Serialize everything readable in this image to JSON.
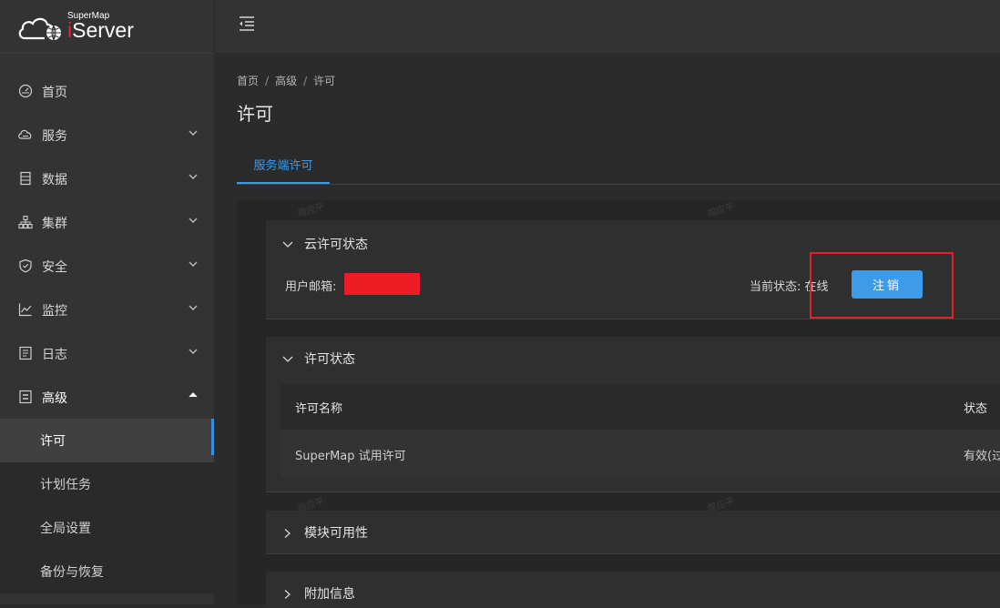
{
  "brand": {
    "small": "SuperMap",
    "prefix": "i",
    "name": "Server"
  },
  "sidebar": {
    "items": [
      {
        "label": "首页",
        "icon": "dashboard-icon",
        "has_children": false
      },
      {
        "label": "服务",
        "icon": "cloud-service-icon",
        "has_children": true
      },
      {
        "label": "数据",
        "icon": "database-icon",
        "has_children": true
      },
      {
        "label": "集群",
        "icon": "cluster-icon",
        "has_children": true
      },
      {
        "label": "安全",
        "icon": "shield-icon",
        "has_children": true
      },
      {
        "label": "监控",
        "icon": "line-chart-icon",
        "has_children": true
      },
      {
        "label": "日志",
        "icon": "log-icon",
        "has_children": true
      },
      {
        "label": "高级",
        "icon": "advanced-icon",
        "has_children": true,
        "expanded": true
      }
    ],
    "submenu": [
      {
        "label": "许可",
        "active": true
      },
      {
        "label": "计划任务"
      },
      {
        "label": "全局设置"
      },
      {
        "label": "备份与恢复"
      }
    ]
  },
  "breadcrumb": [
    "首页",
    "高级",
    "许可"
  ],
  "page_title": "许可",
  "tabs": [
    {
      "label": "服务端许可",
      "active": true
    }
  ],
  "cloud_license": {
    "title": "云许可状态",
    "email_label": "用户邮箱:",
    "status_label": "当前状态: 在线",
    "logout_label": "注销"
  },
  "license_status": {
    "title": "许可状态",
    "columns": [
      "许可名称",
      "状态"
    ],
    "rows": [
      {
        "name": "SuperMap 试用许可",
        "status": "有效(过"
      }
    ]
  },
  "module_availability": {
    "title": "模块可用性"
  },
  "extra_info": {
    "title": "附加信息"
  },
  "watermark": "周应平",
  "colors": {
    "accent": "#3a9cf0",
    "button": "#3d9be9",
    "highlight": "#e0202a",
    "redacted": "#ee1c25"
  }
}
